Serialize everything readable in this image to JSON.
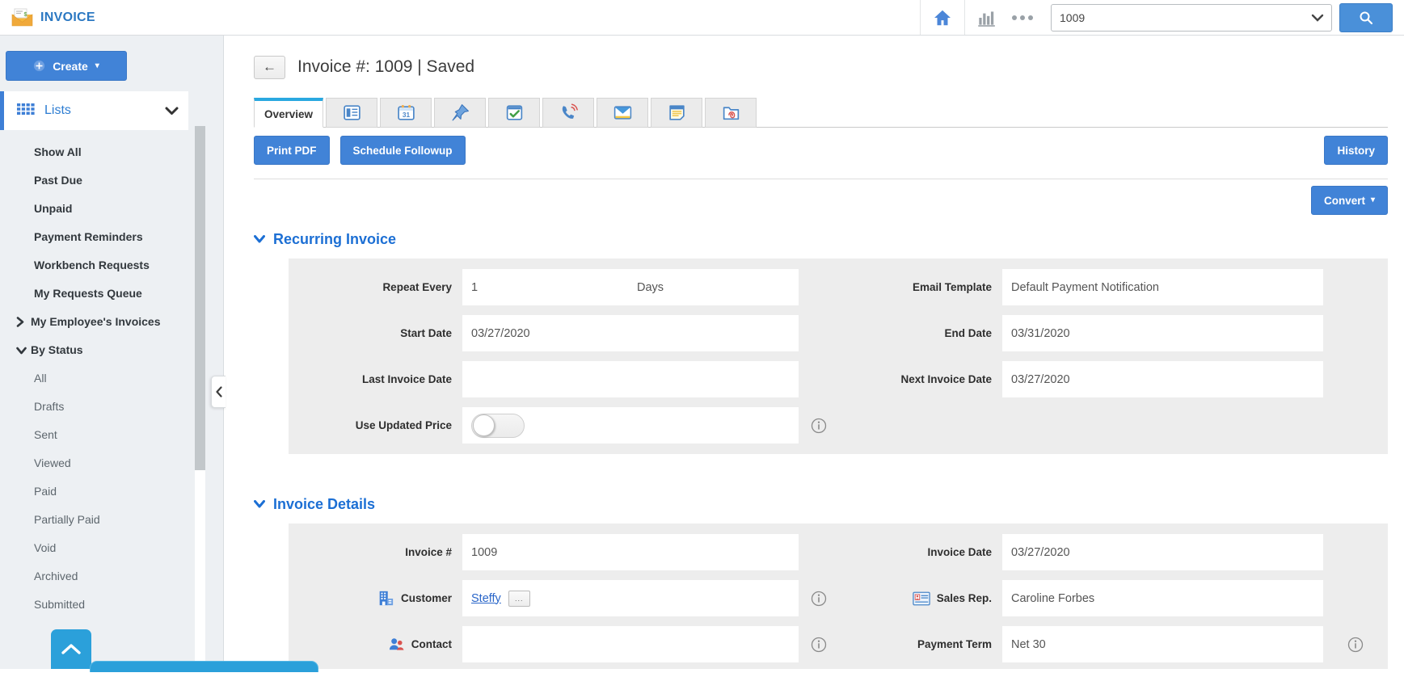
{
  "topbar": {
    "app_title": "INVOICE",
    "search_value": "1009"
  },
  "sidebar": {
    "create_label": "Create",
    "lists_label": "Lists",
    "items": [
      {
        "label": "Show All"
      },
      {
        "label": "Past Due"
      },
      {
        "label": "Unpaid"
      },
      {
        "label": "Payment Reminders"
      },
      {
        "label": "Workbench Requests"
      },
      {
        "label": "My Requests Queue"
      },
      {
        "label": "My Employee's Invoices"
      },
      {
        "label": "By Status"
      },
      {
        "label": "All"
      },
      {
        "label": "Drafts"
      },
      {
        "label": "Sent"
      },
      {
        "label": "Viewed"
      },
      {
        "label": "Paid"
      },
      {
        "label": "Partially Paid"
      },
      {
        "label": "Void"
      },
      {
        "label": "Archived"
      },
      {
        "label": "Submitted"
      }
    ]
  },
  "header": {
    "title": "Invoice #: 1009 | Saved"
  },
  "tabs": {
    "overview_label": "Overview",
    "calendar_day": "31",
    "icon_tabs": [
      "news-feed",
      "calendar",
      "pin",
      "tasks",
      "call",
      "email",
      "notes",
      "documents"
    ]
  },
  "actions": {
    "print_pdf": "Print PDF",
    "schedule_followup": "Schedule Followup",
    "history": "History",
    "convert": "Convert"
  },
  "recurring": {
    "title": "Recurring Invoice",
    "repeat_every_label": "Repeat Every",
    "repeat_every_value": "1",
    "repeat_every_unit": "Days",
    "email_template_label": "Email Template",
    "email_template_value": "Default Payment Notification",
    "start_date_label": "Start Date",
    "start_date_value": "03/27/2020",
    "end_date_label": "End Date",
    "end_date_value": "03/31/2020",
    "last_invoice_date_label": "Last Invoice Date",
    "last_invoice_date_value": "",
    "next_invoice_date_label": "Next Invoice Date",
    "next_invoice_date_value": "03/27/2020",
    "use_updated_price_label": "Use Updated Price"
  },
  "details": {
    "title": "Invoice Details",
    "invoice_no_label": "Invoice #",
    "invoice_no_value": "1009",
    "invoice_date_label": "Invoice Date",
    "invoice_date_value": "03/27/2020",
    "customer_label": "Customer",
    "customer_value": "Steffy",
    "customer_more": "...",
    "sales_rep_label": "Sales Rep.",
    "sales_rep_value": "Caroline Forbes",
    "contact_label": "Contact",
    "contact_value": "",
    "payment_term_label": "Payment Term",
    "payment_term_value": "Net 30"
  },
  "colors": {
    "accent_blue": "#4183d7",
    "tab_highlight": "#29a8e0",
    "section_title_blue": "#1c6fd4",
    "brand_blue": "#2b78c2",
    "link_blue": "#2a66c9",
    "bottom_bar_blue": "#2ba0da",
    "sidebar_bg": "#edf0f3",
    "panel_bg": "#ededed"
  }
}
